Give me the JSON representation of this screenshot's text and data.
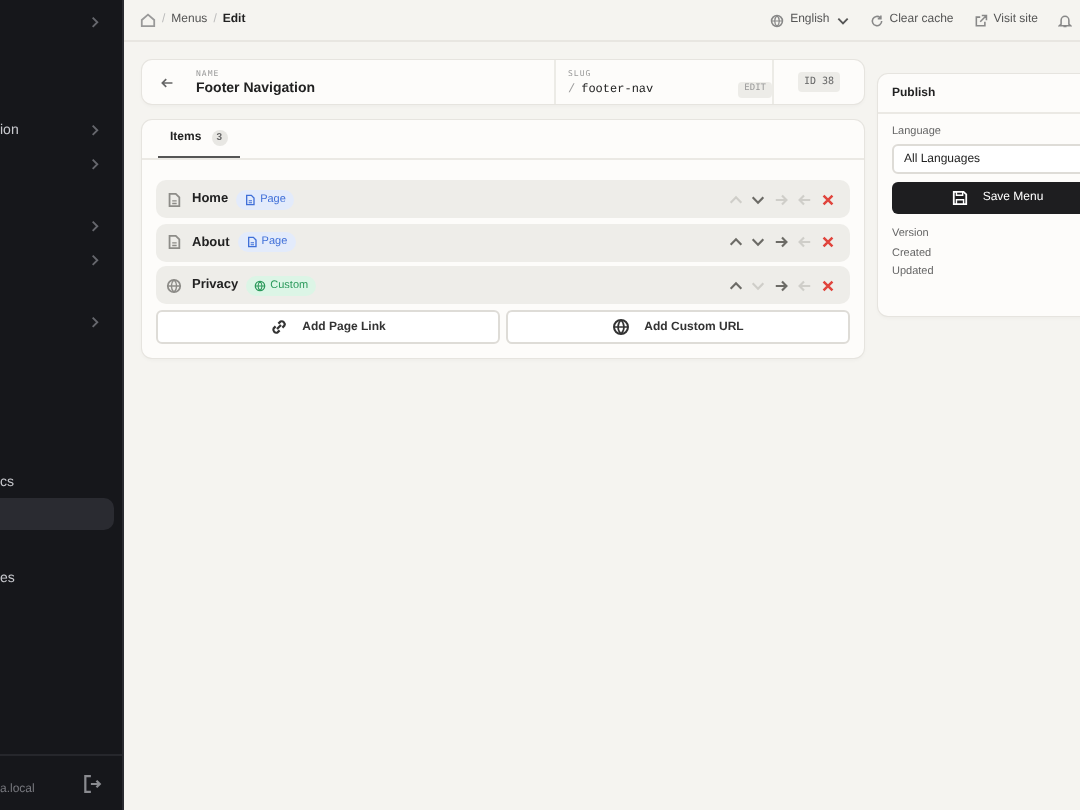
{
  "sidebar": {
    "items": [
      {
        "chevron": true,
        "selected": false
      },
      {
        "label": "ion",
        "chevron": true,
        "selected": false
      },
      {
        "chevron": true,
        "selected": false
      },
      {
        "chevron": true,
        "selected": false
      },
      {
        "chevron": true,
        "selected": false
      },
      {
        "chevron": true,
        "selected": false
      },
      {
        "label": "cs",
        "chevron": false,
        "selected": false
      },
      {
        "chevron": false,
        "selected": true
      },
      {
        "label": "es",
        "chevron": false,
        "selected": false
      }
    ],
    "footer": "a.local"
  },
  "breadcrumb": {
    "separator": "/",
    "items": [
      "Menus",
      "Edit"
    ]
  },
  "topbar": {
    "language": "English",
    "clear_cache": "Clear cache",
    "visit_site": "Visit site"
  },
  "header": {
    "name_label": "NAME",
    "name": "Footer Navigation",
    "slug_label": "SLUG",
    "slug_prefix": "/",
    "slug": "footer-nav",
    "edit": "EDIT",
    "id": "ID 38"
  },
  "tabs": [
    {
      "label": "Items",
      "count": "3",
      "selected": true
    }
  ],
  "items": [
    {
      "title": "Home",
      "kind": "page",
      "badge": "Page",
      "actions": [
        {
          "kind": "up",
          "disabled": true
        },
        {
          "kind": "down",
          "disabled": false
        },
        {
          "kind": "indent",
          "disabled": true
        },
        {
          "kind": "outdent",
          "disabled": true
        },
        {
          "kind": "delete",
          "disabled": false
        }
      ]
    },
    {
      "title": "About",
      "kind": "page",
      "badge": "Page",
      "actions": [
        {
          "kind": "up",
          "disabled": false
        },
        {
          "kind": "down",
          "disabled": false
        },
        {
          "kind": "indent",
          "disabled": false
        },
        {
          "kind": "outdent",
          "disabled": true
        },
        {
          "kind": "delete",
          "disabled": false
        }
      ]
    },
    {
      "title": "Privacy",
      "kind": "custom",
      "badge": "Custom",
      "actions": [
        {
          "kind": "up",
          "disabled": false
        },
        {
          "kind": "down",
          "disabled": true
        },
        {
          "kind": "indent",
          "disabled": false
        },
        {
          "kind": "outdent",
          "disabled": true
        },
        {
          "kind": "delete",
          "disabled": false
        }
      ]
    }
  ],
  "add_buttons": [
    {
      "kind": "link",
      "label": "Add Page Link"
    },
    {
      "kind": "globe",
      "label": "Add Custom URL"
    }
  ],
  "publish": {
    "title": "Publish",
    "language_label": "Language",
    "language": "All Languages",
    "save": "Save Menu",
    "meta": [
      "Version",
      "Created",
      "Updated"
    ]
  }
}
